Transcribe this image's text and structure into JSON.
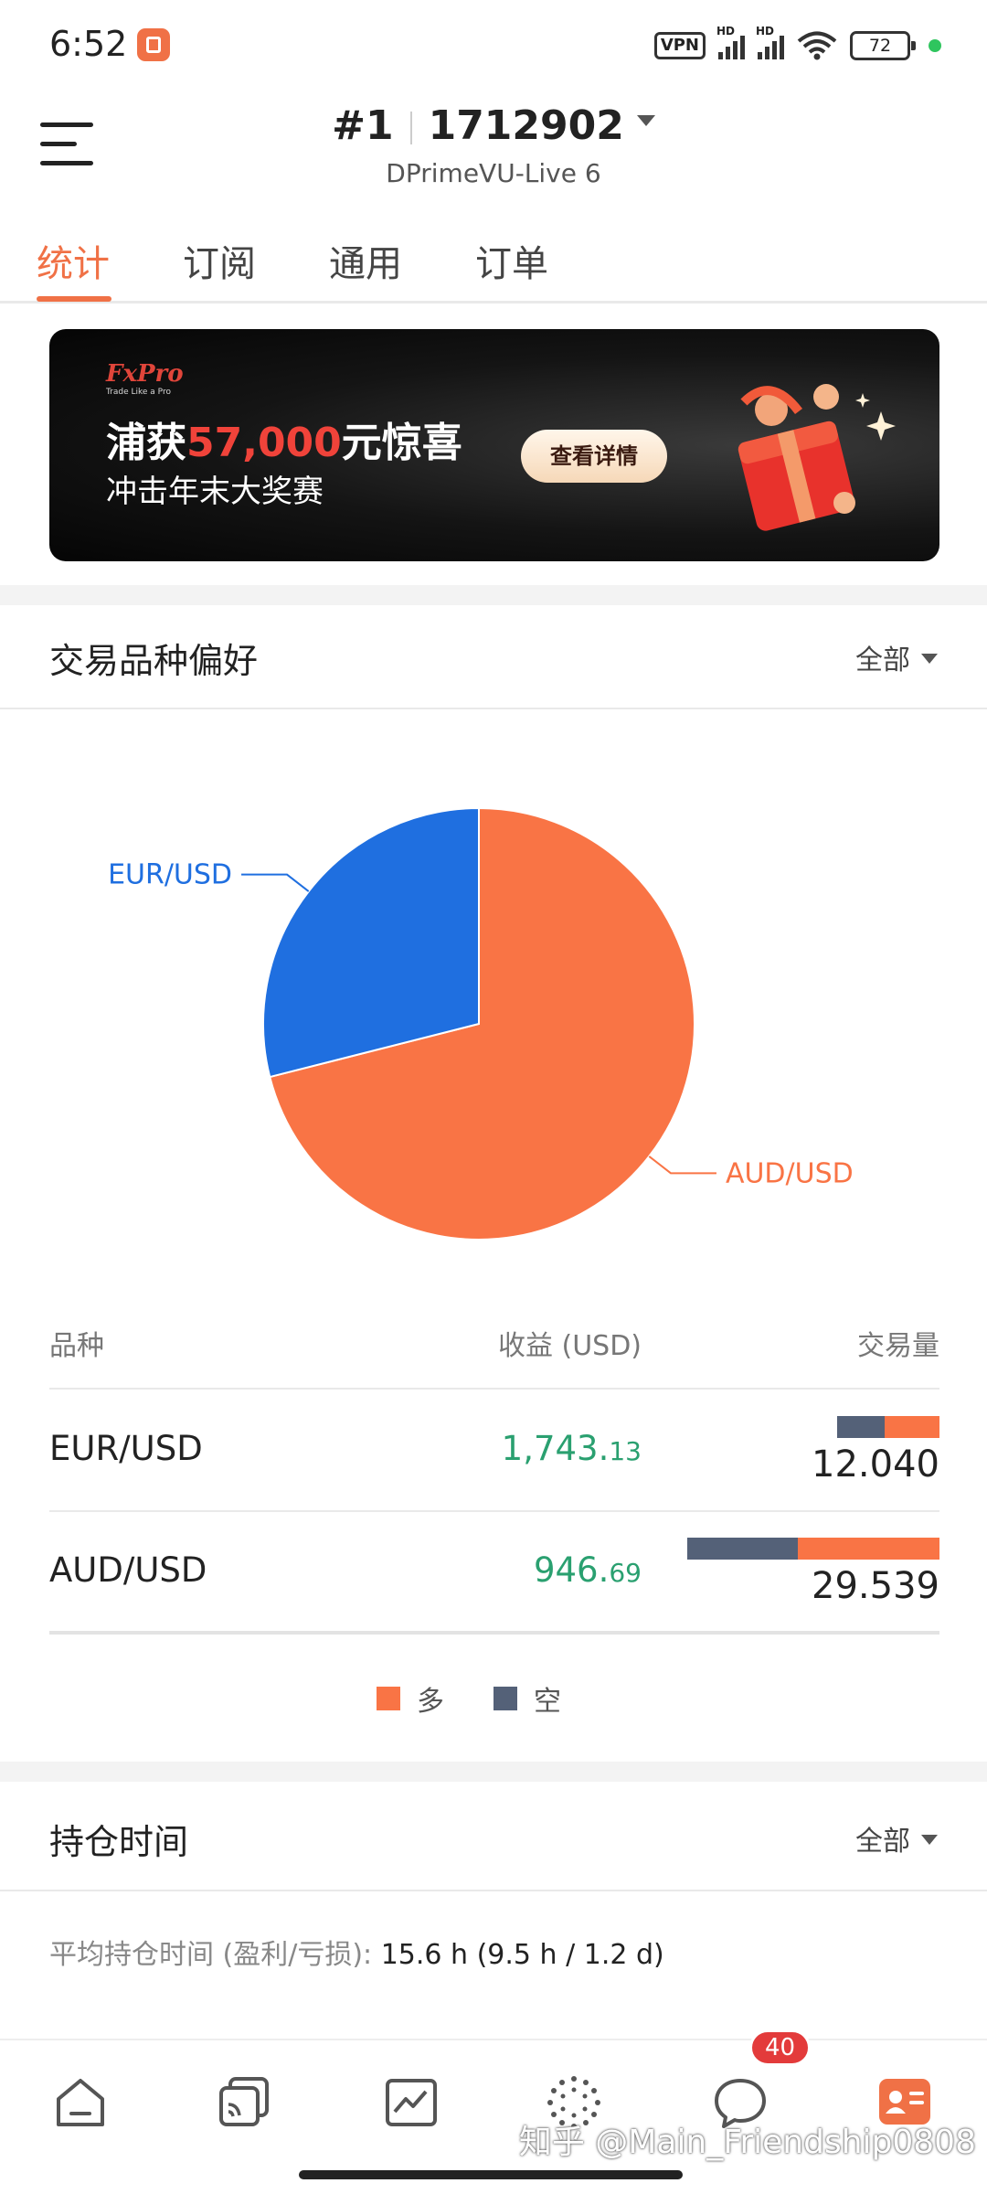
{
  "status_bar": {
    "time": "6:52",
    "vpn": "VPN",
    "signal_label": "HD",
    "battery": "72"
  },
  "header": {
    "account_number": "#1",
    "account_id": "1712902",
    "server": "DPrimeVU-Live 6"
  },
  "tabs": [
    {
      "label": "统计",
      "active": true
    },
    {
      "label": "订阅",
      "active": false
    },
    {
      "label": "通用",
      "active": false
    },
    {
      "label": "订单",
      "active": false
    }
  ],
  "banner": {
    "brand": "FxPro",
    "tagline": "Trade Like a Pro",
    "headline_prefix": "浦获",
    "headline_amount": "57,000",
    "headline_suffix": "元惊喜",
    "subline": "冲击年末大奖赛",
    "cta_label": "查看详情"
  },
  "preference_section": {
    "title": "交易品种偏好",
    "filter_label": "全部"
  },
  "chart_data": {
    "type": "pie",
    "slices": [
      {
        "label": "AUD/USD",
        "value": 29.539,
        "color": "#f97445"
      },
      {
        "label": "EUR/USD",
        "value": 12.04,
        "color": "#1f6fe0"
      }
    ]
  },
  "table": {
    "headers": {
      "symbol": "品种",
      "profit": "收益 (USD)",
      "volume": "交易量"
    },
    "rows": [
      {
        "symbol": "EUR/USD",
        "profit_int": "1,743.",
        "profit_dec": "13",
        "volume": "12.040",
        "short_fraction": 0.47,
        "long_fraction": 0.53
      },
      {
        "symbol": "AUD/USD",
        "profit_int": "946.",
        "profit_dec": "69",
        "volume": "29.539",
        "short_fraction": 0.44,
        "long_fraction": 0.56
      }
    ]
  },
  "legend": {
    "long_label": "多",
    "short_label": "空",
    "long_color": "#f97445",
    "short_color": "#546178"
  },
  "holding_section": {
    "title": "持仓时间",
    "filter_label": "全部",
    "avg_label": "平均持仓时间 (盈利/亏损): ",
    "avg_value": "15.6 h (9.5 h / 1.2 d)"
  },
  "bottom_nav": {
    "items": [
      "home-icon",
      "accounts-icon",
      "chart-icon",
      "community-icon",
      "messages-icon",
      "profile-icon"
    ],
    "messages_badge": "40",
    "accent": "#f07146",
    "watermark": "知乎 @Main_Friendship0808"
  }
}
